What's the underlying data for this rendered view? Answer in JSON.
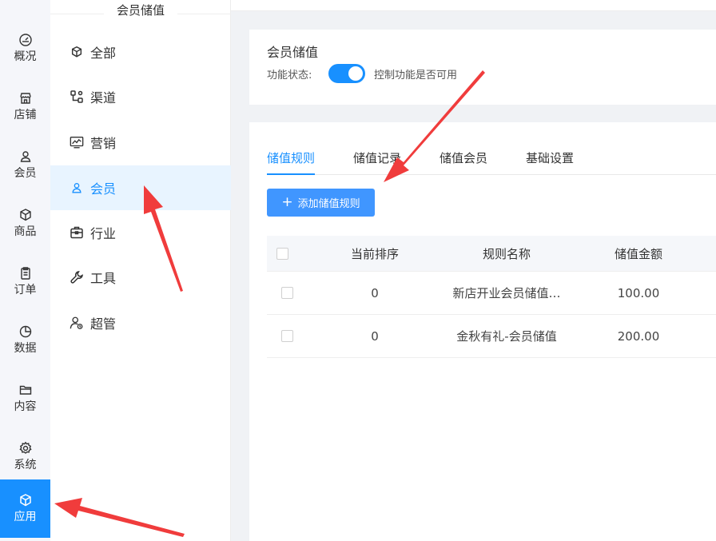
{
  "rail": {
    "items": [
      {
        "label": "概况",
        "icon": "gauge-icon"
      },
      {
        "label": "店铺",
        "icon": "store-icon"
      },
      {
        "label": "会员",
        "icon": "user-icon"
      },
      {
        "label": "商品",
        "icon": "box-icon"
      },
      {
        "label": "订单",
        "icon": "clipboard-icon"
      },
      {
        "label": "数据",
        "icon": "pie-chart-icon"
      },
      {
        "label": "内容",
        "icon": "folder-icon"
      },
      {
        "label": "系统",
        "icon": "gear-icon"
      },
      {
        "label": "应用",
        "icon": "cube-icon"
      }
    ],
    "active_index": 8,
    "accent": "#1890ff"
  },
  "sidebar": {
    "title": "会员储值",
    "items": [
      {
        "label": "全部",
        "icon": "cube-icon"
      },
      {
        "label": "渠道",
        "icon": "channel-icon"
      },
      {
        "label": "营销",
        "icon": "marketing-chart-icon"
      },
      {
        "label": "会员",
        "icon": "user-icon"
      },
      {
        "label": "行业",
        "icon": "briefcase-icon"
      },
      {
        "label": "工具",
        "icon": "wrench-icon"
      },
      {
        "label": "超管",
        "icon": "admin-user-icon"
      }
    ],
    "active_index": 3
  },
  "header_card": {
    "title": "会员储值",
    "status_label": "功能状态:",
    "switch_on": true,
    "description": "控制功能是否可用"
  },
  "tabs": [
    "储值规则",
    "储值记录",
    "储值会员",
    "基础设置"
  ],
  "active_tab": 0,
  "add_button": {
    "label": "添加储值规则",
    "icon": "plus-icon"
  },
  "table": {
    "headers": [
      "当前排序",
      "规则名称",
      "储值金额"
    ],
    "rows": [
      {
        "sort": "0",
        "name": "新店开业会员储值…",
        "amount": "100.00"
      },
      {
        "sort": "0",
        "name": "金秋有礼-会员储值",
        "amount": "200.00"
      }
    ]
  },
  "colors": {
    "primary": "#1890ff",
    "arrow": "#f03c3c"
  }
}
